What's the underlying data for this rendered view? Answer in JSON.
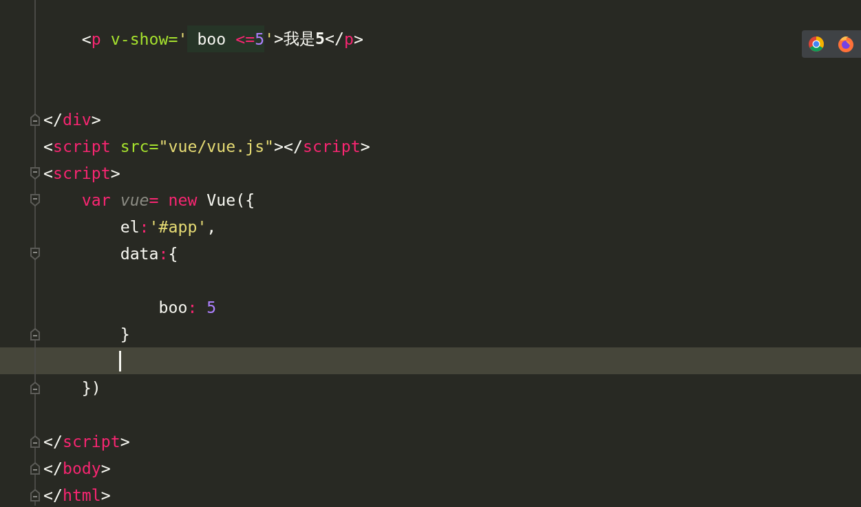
{
  "lines": [
    {
      "current": false,
      "fold_start": false,
      "fold_end": false
    },
    {
      "current": false,
      "fold_start": false,
      "fold_end": false,
      "tokens": [
        {
          "text": "    <",
          "kind": "plain",
          "highlight": false
        },
        {
          "text": "p",
          "kind": "tag",
          "highlight": false
        },
        {
          "text": " v-show=",
          "kind": "attr",
          "highlight": false
        },
        {
          "text": "'",
          "kind": "string",
          "highlight": false
        },
        {
          "text": " boo ",
          "kind": "plain",
          "highlight": true
        },
        {
          "text": "<=",
          "kind": "op",
          "highlight": true
        },
        {
          "text": "5",
          "kind": "number",
          "highlight": true
        },
        {
          "text": "'",
          "kind": "string",
          "highlight": false
        },
        {
          "text": ">我是**5**</",
          "kind": "plain",
          "highlight": false
        },
        {
          "text": "p",
          "kind": "tag",
          "highlight": false
        },
        {
          "text": ">",
          "kind": "plain",
          "highlight": false
        }
      ]
    },
    {
      "current": false,
      "fold_start": false,
      "fold_end": false
    },
    {
      "current": false,
      "fold_start": false,
      "fold_end": false
    },
    {
      "current": false,
      "fold_start": false,
      "fold_end": true,
      "tokens": [
        {
          "text": "</",
          "kind": "plain"
        },
        {
          "text": "div",
          "kind": "tag"
        },
        {
          "text": ">",
          "kind": "plain"
        }
      ]
    },
    {
      "current": false,
      "fold_start": false,
      "fold_end": false,
      "tokens": [
        {
          "text": "<",
          "kind": "plain"
        },
        {
          "text": "script",
          "kind": "tag"
        },
        {
          "text": " src=",
          "kind": "attr"
        },
        {
          "text": "\"vue/vue.js\"",
          "kind": "string"
        },
        {
          "text": "></",
          "kind": "plain"
        },
        {
          "text": "script",
          "kind": "tag"
        },
        {
          "text": ">",
          "kind": "plain"
        }
      ]
    },
    {
      "current": false,
      "fold_start": true,
      "fold_end": false,
      "tokens": [
        {
          "text": "<",
          "kind": "plain"
        },
        {
          "text": "script",
          "kind": "tag"
        },
        {
          "text": ">",
          "kind": "plain"
        }
      ]
    },
    {
      "current": false,
      "fold_start": true,
      "fold_end": false,
      "tokens": [
        {
          "text": "    var ",
          "kind": "keyword"
        },
        {
          "text": "vue",
          "kind": "variable"
        },
        {
          "text": "= new ",
          "kind": "keyword"
        },
        {
          "text": "Vue({",
          "kind": "plain"
        }
      ]
    },
    {
      "current": false,
      "fold_start": false,
      "fold_end": false,
      "tokens": [
        {
          "text": "        el",
          "kind": "plain"
        },
        {
          "text": ":",
          "kind": "op"
        },
        {
          "text": "'#app'",
          "kind": "string"
        },
        {
          "text": ",",
          "kind": "plain"
        }
      ]
    },
    {
      "current": false,
      "fold_start": true,
      "fold_end": false,
      "tokens": [
        {
          "text": "        data",
          "kind": "plain"
        },
        {
          "text": ":",
          "kind": "op"
        },
        {
          "text": "{",
          "kind": "plain"
        }
      ]
    },
    {
      "current": false,
      "fold_start": false,
      "fold_end": false
    },
    {
      "current": false,
      "fold_start": false,
      "fold_end": false,
      "tokens": [
        {
          "text": "            boo",
          "kind": "plain"
        },
        {
          "text": ": ",
          "kind": "op"
        },
        {
          "text": "5",
          "kind": "number"
        }
      ]
    },
    {
      "current": false,
      "fold_start": false,
      "fold_end": true,
      "tokens": [
        {
          "text": "        }",
          "kind": "plain"
        }
      ]
    },
    {
      "current": true,
      "fold_start": false,
      "fold_end": false
    },
    {
      "current": false,
      "fold_start": false,
      "fold_end": true,
      "tokens": [
        {
          "text": "    })",
          "kind": "plain"
        }
      ]
    },
    {
      "current": false,
      "fold_start": false,
      "fold_end": false
    },
    {
      "current": false,
      "fold_start": false,
      "fold_end": true,
      "tokens": [
        {
          "text": "</",
          "kind": "plain"
        },
        {
          "text": "script",
          "kind": "tag"
        },
        {
          "text": ">",
          "kind": "plain"
        }
      ]
    },
    {
      "current": false,
      "fold_start": false,
      "fold_end": true,
      "tokens": [
        {
          "text": "</",
          "kind": "plain"
        },
        {
          "text": "body",
          "kind": "tag"
        },
        {
          "text": ">",
          "kind": "plain"
        }
      ]
    },
    {
      "current": false,
      "fold_start": false,
      "fold_end": true,
      "tokens": [
        {
          "text": "</",
          "kind": "plain"
        },
        {
          "text": "html",
          "kind": "tag"
        },
        {
          "text": ">",
          "kind": "plain"
        }
      ]
    }
  ]
}
